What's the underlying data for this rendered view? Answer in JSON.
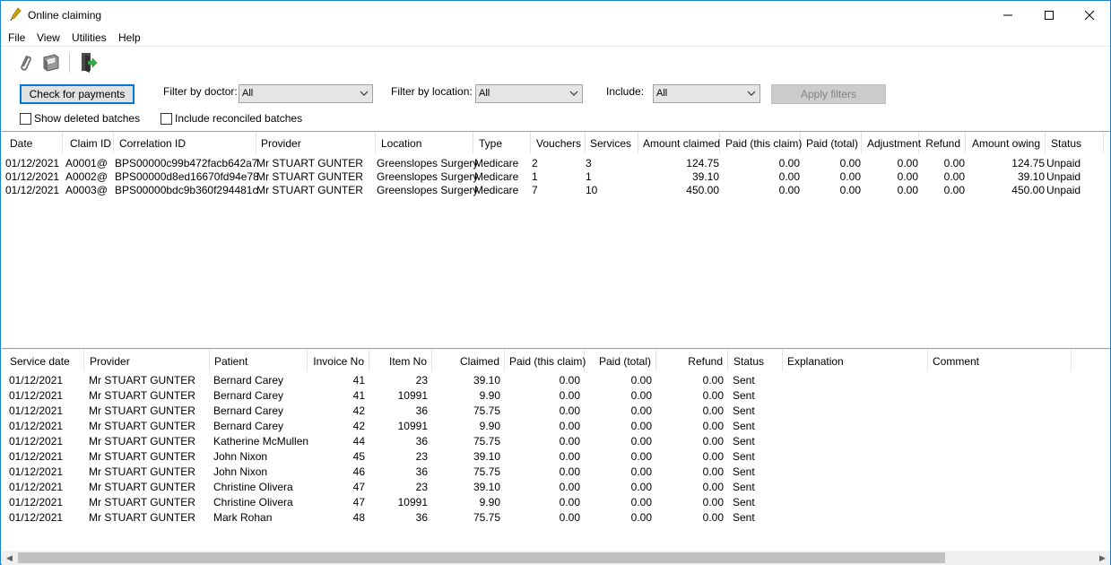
{
  "window": {
    "title": "Online claiming"
  },
  "menu": [
    "File",
    "View",
    "Utilities",
    "Help"
  ],
  "toolbar": {
    "icons": [
      "paperclip-icon",
      "printer-icon",
      "exit-icon"
    ]
  },
  "filters": {
    "check_payments": "Check for payments",
    "doctor_label": "Filter by doctor:",
    "doctor_value": "All",
    "location_label": "Filter by location:",
    "location_value": "All",
    "include_label": "Include:",
    "include_value": "All",
    "apply": "Apply filters",
    "show_deleted": "Show deleted batches",
    "include_reconciled": "Include reconciled batches"
  },
  "batches": {
    "columns": [
      "Date",
      "Claim ID",
      "Correlation ID",
      "Provider",
      "Location",
      "Type",
      "Vouchers",
      "Services",
      "Amount claimed",
      "Paid (this claim)",
      "Paid (total)",
      "Adjustment",
      "Refund",
      "Amount owing",
      "Status"
    ],
    "rows": [
      [
        "01/12/2021",
        "A0001@",
        "BPS00000c99b472facb642a7",
        "Mr STUART GUNTER",
        "Greenslopes Surgery",
        "Medicare",
        "2",
        "3",
        "124.75",
        "0.00",
        "0.00",
        "0.00",
        "0.00",
        "124.75",
        "Unpaid"
      ],
      [
        "01/12/2021",
        "A0002@",
        "BPS00000d8ed16670fd94e78",
        "Mr STUART GUNTER",
        "Greenslopes Surgery",
        "Medicare",
        "1",
        "1",
        "39.10",
        "0.00",
        "0.00",
        "0.00",
        "0.00",
        "39.10",
        "Unpaid"
      ],
      [
        "01/12/2021",
        "A0003@",
        "BPS00000bdc9b360f294481c",
        "Mr STUART GUNTER",
        "Greenslopes Surgery",
        "Medicare",
        "7",
        "10",
        "450.00",
        "0.00",
        "0.00",
        "0.00",
        "0.00",
        "450.00",
        "Unpaid"
      ]
    ]
  },
  "services": {
    "columns": [
      "Service date",
      "Provider",
      "Patient",
      "Invoice No",
      "Item No",
      "Claimed",
      "Paid (this claim)",
      "Paid (total)",
      "Refund",
      "Status",
      "Explanation",
      "Comment"
    ],
    "rows": [
      [
        "01/12/2021",
        "Mr STUART GUNTER",
        "Bernard Carey",
        "41",
        "23",
        "39.10",
        "0.00",
        "0.00",
        "0.00",
        "Sent",
        "",
        ""
      ],
      [
        "01/12/2021",
        "Mr STUART GUNTER",
        "Bernard Carey",
        "41",
        "10991",
        "9.90",
        "0.00",
        "0.00",
        "0.00",
        "Sent",
        "",
        ""
      ],
      [
        "01/12/2021",
        "Mr STUART GUNTER",
        "Bernard Carey",
        "42",
        "36",
        "75.75",
        "0.00",
        "0.00",
        "0.00",
        "Sent",
        "",
        ""
      ],
      [
        "01/12/2021",
        "Mr STUART GUNTER",
        "Bernard Carey",
        "42",
        "10991",
        "9.90",
        "0.00",
        "0.00",
        "0.00",
        "Sent",
        "",
        ""
      ],
      [
        "01/12/2021",
        "Mr STUART GUNTER",
        "Katherine McMullen",
        "44",
        "36",
        "75.75",
        "0.00",
        "0.00",
        "0.00",
        "Sent",
        "",
        ""
      ],
      [
        "01/12/2021",
        "Mr STUART GUNTER",
        "John Nixon",
        "45",
        "23",
        "39.10",
        "0.00",
        "0.00",
        "0.00",
        "Sent",
        "",
        ""
      ],
      [
        "01/12/2021",
        "Mr STUART GUNTER",
        "John Nixon",
        "46",
        "36",
        "75.75",
        "0.00",
        "0.00",
        "0.00",
        "Sent",
        "",
        ""
      ],
      [
        "01/12/2021",
        "Mr STUART GUNTER",
        "Christine Olivera",
        "47",
        "23",
        "39.10",
        "0.00",
        "0.00",
        "0.00",
        "Sent",
        "",
        ""
      ],
      [
        "01/12/2021",
        "Mr STUART GUNTER",
        "Christine Olivera",
        "47",
        "10991",
        "9.90",
        "0.00",
        "0.00",
        "0.00",
        "Sent",
        "",
        ""
      ],
      [
        "01/12/2021",
        "Mr STUART GUNTER",
        "Mark Rohan",
        "48",
        "36",
        "75.75",
        "0.00",
        "0.00",
        "0.00",
        "Sent",
        "",
        ""
      ]
    ]
  }
}
